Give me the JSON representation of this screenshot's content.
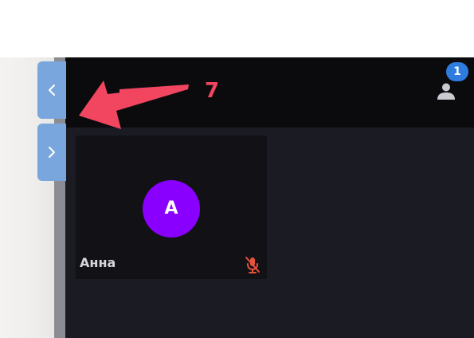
{
  "header": {
    "participant_count": "1",
    "participants_icon": "person-icon"
  },
  "tile": {
    "avatar_initial": "A",
    "participant_name": "Анна",
    "mic_icon": "mic-off-icon",
    "avatar_color": "#8a00ff"
  },
  "side_buttons": {
    "collapse_icon": "chevron-left-icon",
    "expand_icon": "chevron-right-icon",
    "color": "#79a6dc"
  },
  "annotation": {
    "number": "7",
    "color": "#f24560"
  },
  "colors": {
    "header_bg": "#0b0b0e",
    "content_bg": "#1a1b23",
    "badge_bg": "#2e7ce0",
    "muted_mic": "#e5533b"
  }
}
